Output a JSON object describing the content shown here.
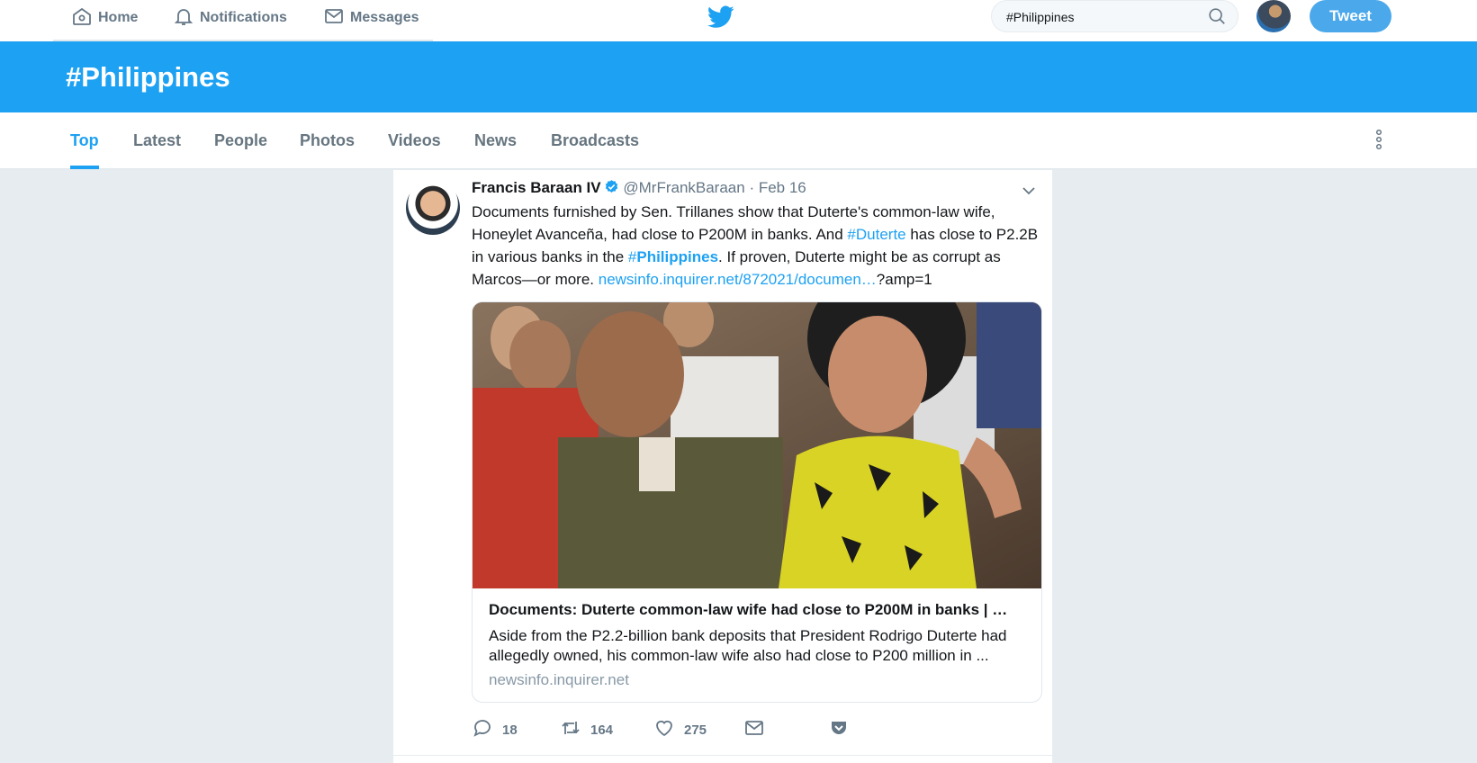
{
  "nav": {
    "home_label": "Home",
    "notifications_label": "Notifications",
    "messages_label": "Messages"
  },
  "search": {
    "value": "#Philippines"
  },
  "tweet_button_label": "Tweet",
  "banner": {
    "title": "#Philippines"
  },
  "tabs": [
    {
      "label": "Top",
      "active": true
    },
    {
      "label": "Latest"
    },
    {
      "label": "People"
    },
    {
      "label": "Photos"
    },
    {
      "label": "Videos"
    },
    {
      "label": "News"
    },
    {
      "label": "Broadcasts"
    }
  ],
  "tweet": {
    "name": "Francis Baraan IV",
    "handle": "@MrFrankBaraan",
    "date": "· Feb 16",
    "text_1": "Documents furnished by Sen. Trillanes show that Duterte's common-law wife, Honeylet Avanceña, had close to P200M in banks. And ",
    "hashtag_1": "#Duterte",
    "text_2": " has close to P2.2B in various banks in the ",
    "hashtag_2_prefix": "#",
    "hashtag_2": "Philippines",
    "text_3": ". If proven, Duterte might be as corrupt as Marcos—or more. ",
    "link": "newsinfo.inquirer.net/872021/documen…",
    "link_suffix": "?amp=1",
    "card": {
      "title": "Documents: Duterte common-law wife had close to P200M in banks | …",
      "description": "Aside from the P2.2-billion bank deposits that President Rodrigo Duterte had allegedly owned, his common-law wife also had close to P200 million in ...",
      "domain": "newsinfo.inquirer.net"
    },
    "replies": "18",
    "retweets": "164",
    "likes": "275"
  },
  "colors": {
    "accent": "#1da1f2",
    "banner": "#1da1f2",
    "tweet_button": "#4aa8eb"
  },
  "icons": [
    "home-icon",
    "bell-icon",
    "envelope-icon",
    "twitter-bird-icon",
    "search-icon",
    "more-vertical-icon",
    "verified-icon",
    "chevron-down-icon",
    "reply-icon",
    "retweet-icon",
    "heart-icon",
    "dm-icon",
    "pocket-icon"
  ]
}
